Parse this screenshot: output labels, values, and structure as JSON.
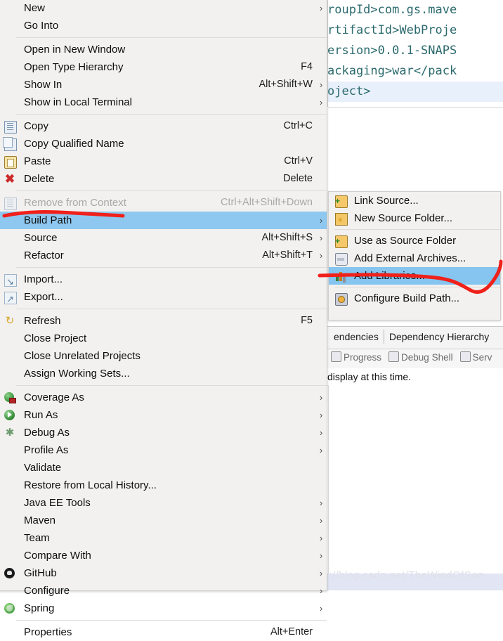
{
  "editor": {
    "lines": [
      "roupId>com.gs.mave",
      "rtifactId>WebProje",
      "ersion>0.0.1-SNAPS",
      "ackaging>war</pack",
      "oject>"
    ]
  },
  "editor_tabs": [
    {
      "label": "endencies"
    },
    {
      "label": "Dependency Hierarchy"
    }
  ],
  "view_tabs": [
    {
      "label": "Progress",
      "icon": "progress-icon"
    },
    {
      "label": "Debug Shell",
      "icon": "debug-shell-icon"
    },
    {
      "label": "Serv",
      "icon": "servers-icon"
    }
  ],
  "status": {
    "text": "display at this time."
  },
  "watermark": {
    "text": "https://blog.csdn.net/TheWindOfSon"
  },
  "context_menu": {
    "groups": [
      {
        "items": [
          {
            "label": "New",
            "accel": "",
            "arrow": true,
            "icon": "",
            "disabled": false,
            "selected": false
          },
          {
            "label": "Go Into",
            "accel": "",
            "arrow": false,
            "icon": "",
            "disabled": false,
            "selected": false
          }
        ]
      },
      {
        "items": [
          {
            "label": "Open in New Window",
            "accel": "",
            "arrow": false,
            "icon": "",
            "disabled": false,
            "selected": false
          },
          {
            "label": "Open Type Hierarchy",
            "accel": "F4",
            "arrow": false,
            "icon": "",
            "disabled": false,
            "selected": false
          },
          {
            "label": "Show In",
            "accel": "Alt+Shift+W",
            "arrow": true,
            "icon": "",
            "disabled": false,
            "selected": false
          },
          {
            "label": "Show in Local Terminal",
            "accel": "",
            "arrow": true,
            "icon": "",
            "disabled": false,
            "selected": false
          }
        ]
      },
      {
        "items": [
          {
            "label": "Copy",
            "accel": "Ctrl+C",
            "arrow": false,
            "icon": "copy-icon",
            "disabled": false,
            "selected": false
          },
          {
            "label": "Copy Qualified Name",
            "accel": "",
            "arrow": false,
            "icon": "copy-qualified-name-icon",
            "disabled": false,
            "selected": false
          },
          {
            "label": "Paste",
            "accel": "Ctrl+V",
            "arrow": false,
            "icon": "paste-icon",
            "disabled": false,
            "selected": false
          },
          {
            "label": "Delete",
            "accel": "Delete",
            "arrow": false,
            "icon": "delete-icon",
            "disabled": false,
            "selected": false
          }
        ]
      },
      {
        "items": [
          {
            "label": "Remove from Context",
            "accel": "Ctrl+Alt+Shift+Down",
            "arrow": false,
            "icon": "remove-from-context-icon",
            "disabled": true,
            "selected": false
          },
          {
            "label": "Build Path",
            "accel": "",
            "arrow": true,
            "icon": "",
            "disabled": false,
            "selected": true
          },
          {
            "label": "Source",
            "accel": "Alt+Shift+S",
            "arrow": true,
            "icon": "",
            "disabled": false,
            "selected": false
          },
          {
            "label": "Refactor",
            "accel": "Alt+Shift+T",
            "arrow": true,
            "icon": "",
            "disabled": false,
            "selected": false
          }
        ]
      },
      {
        "items": [
          {
            "label": "Import...",
            "accel": "",
            "arrow": false,
            "icon": "import-icon",
            "disabled": false,
            "selected": false
          },
          {
            "label": "Export...",
            "accel": "",
            "arrow": false,
            "icon": "export-icon",
            "disabled": false,
            "selected": false
          }
        ]
      },
      {
        "items": [
          {
            "label": "Refresh",
            "accel": "F5",
            "arrow": false,
            "icon": "refresh-icon",
            "disabled": false,
            "selected": false
          },
          {
            "label": "Close Project",
            "accel": "",
            "arrow": false,
            "icon": "",
            "disabled": false,
            "selected": false
          },
          {
            "label": "Close Unrelated Projects",
            "accel": "",
            "arrow": false,
            "icon": "",
            "disabled": false,
            "selected": false
          },
          {
            "label": "Assign Working Sets...",
            "accel": "",
            "arrow": false,
            "icon": "",
            "disabled": false,
            "selected": false
          }
        ]
      },
      {
        "items": [
          {
            "label": "Coverage As",
            "accel": "",
            "arrow": true,
            "icon": "coverage-icon",
            "disabled": false,
            "selected": false
          },
          {
            "label": "Run As",
            "accel": "",
            "arrow": true,
            "icon": "run-icon",
            "disabled": false,
            "selected": false
          },
          {
            "label": "Debug As",
            "accel": "",
            "arrow": true,
            "icon": "debug-icon",
            "disabled": false,
            "selected": false
          },
          {
            "label": "Profile As",
            "accel": "",
            "arrow": true,
            "icon": "",
            "disabled": false,
            "selected": false
          },
          {
            "label": "Validate",
            "accel": "",
            "arrow": false,
            "icon": "",
            "disabled": false,
            "selected": false
          },
          {
            "label": "Restore from Local History...",
            "accel": "",
            "arrow": false,
            "icon": "",
            "disabled": false,
            "selected": false
          },
          {
            "label": "Java EE Tools",
            "accel": "",
            "arrow": true,
            "icon": "",
            "disabled": false,
            "selected": false
          },
          {
            "label": "Maven",
            "accel": "",
            "arrow": true,
            "icon": "",
            "disabled": false,
            "selected": false
          },
          {
            "label": "Team",
            "accel": "",
            "arrow": true,
            "icon": "",
            "disabled": false,
            "selected": false
          },
          {
            "label": "Compare With",
            "accel": "",
            "arrow": true,
            "icon": "",
            "disabled": false,
            "selected": false
          },
          {
            "label": "GitHub",
            "accel": "",
            "arrow": true,
            "icon": "github-icon",
            "disabled": false,
            "selected": false
          },
          {
            "label": "Configure",
            "accel": "",
            "arrow": true,
            "icon": "",
            "disabled": false,
            "selected": false
          },
          {
            "label": "Spring",
            "accel": "",
            "arrow": true,
            "icon": "spring-icon",
            "disabled": false,
            "selected": false
          }
        ]
      },
      {
        "items": [
          {
            "label": "Properties",
            "accel": "Alt+Enter",
            "arrow": false,
            "icon": "",
            "disabled": false,
            "selected": false
          }
        ]
      }
    ]
  },
  "build_path_submenu": {
    "groups": [
      {
        "items": [
          {
            "label": "Link Source...",
            "icon": "link-source-icon",
            "selected": false
          },
          {
            "label": "New Source Folder...",
            "icon": "new-source-folder-icon",
            "selected": false
          }
        ]
      },
      {
        "items": [
          {
            "label": "Use as Source Folder",
            "icon": "use-as-source-folder-icon",
            "selected": false
          },
          {
            "label": "Add External Archives...",
            "icon": "add-external-archives-icon",
            "selected": false
          },
          {
            "label": "Add Libraries...",
            "icon": "add-libraries-icon",
            "selected": true
          }
        ]
      },
      {
        "items": [
          {
            "label": "Configure Build Path...",
            "icon": "configure-build-path-icon",
            "selected": false
          }
        ]
      }
    ]
  },
  "colors": {
    "menu_bg": "#f2f1f0",
    "highlight": "#8ec8f0",
    "annotation_red": "#f01f14",
    "editor_tag": "#2b6a6d"
  },
  "annotations": [
    {
      "name": "build-path-underline"
    },
    {
      "name": "add-libraries-underline"
    }
  ]
}
